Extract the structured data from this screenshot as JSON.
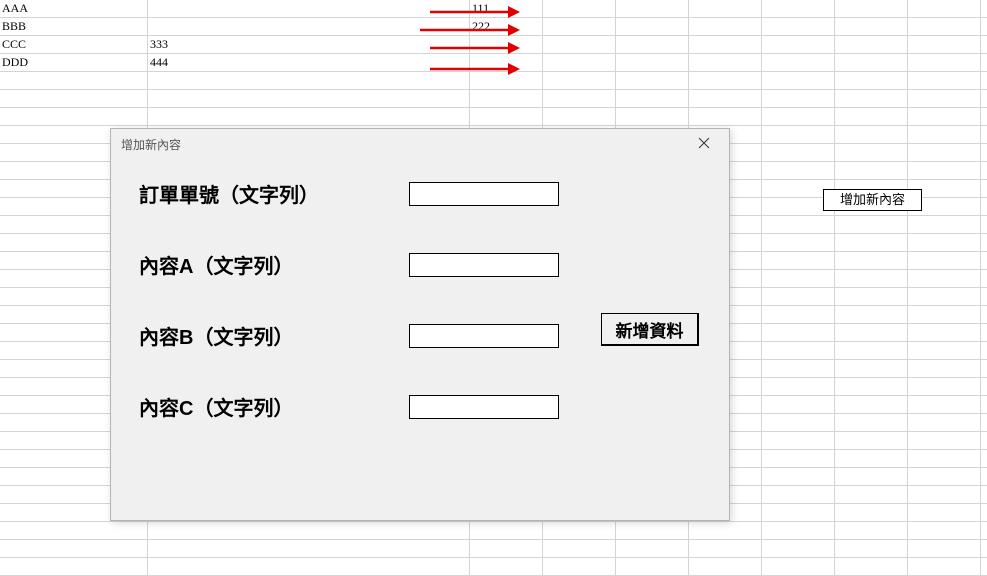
{
  "spreadsheet": {
    "rows": [
      {
        "a": "AAA",
        "b": "",
        "c": "111"
      },
      {
        "a": "BBB",
        "b": "",
        "c": "222"
      },
      {
        "a": "CCC",
        "b": "333",
        "c": ""
      },
      {
        "a": "DDD",
        "b": "444",
        "c": ""
      }
    ]
  },
  "sheet_button_label": "增加新內容",
  "dialog": {
    "title": "增加新內容",
    "labels": {
      "order_no": "訂單單號（文字列）",
      "content_a": "內容A（文字列）",
      "content_b": "內容B（文字列）",
      "content_c": "內容C（文字列）"
    },
    "values": {
      "order_no": "",
      "content_a": "",
      "content_b": "",
      "content_c": ""
    },
    "submit_label": "新增資料"
  }
}
